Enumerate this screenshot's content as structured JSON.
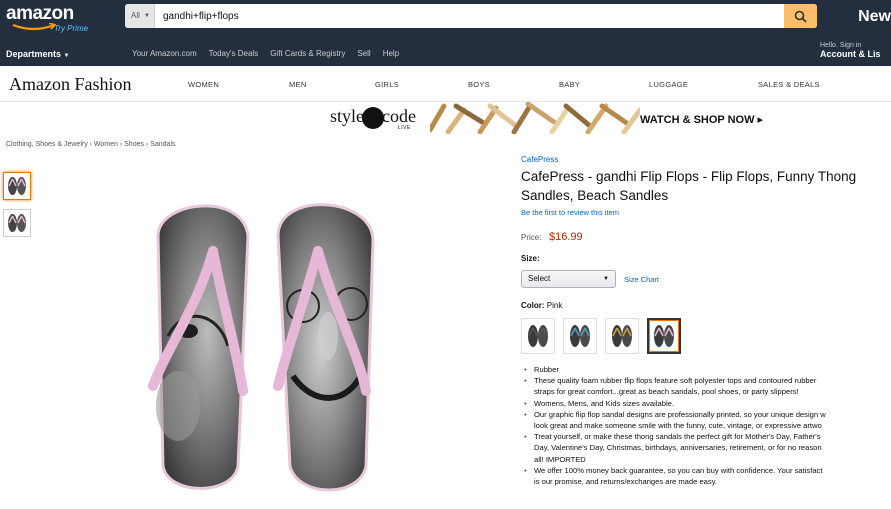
{
  "header": {
    "logo_text": "amazon",
    "logo_sub": "Try Prime",
    "search_category": "All",
    "search_value": "gandhi+flip+flops",
    "right_partial": "New"
  },
  "nav": {
    "departments_label": "Departments",
    "links": [
      "Your Amazon.com",
      "Today's Deals",
      "Gift Cards & Registry",
      "Sell",
      "Help"
    ],
    "hello": "Hello. Sign in",
    "account_label": "Account & Lis"
  },
  "fashion": {
    "logo": "Amazon Fashion",
    "nav": [
      "WOMEN",
      "MEN",
      "GIRLS",
      "BOYS",
      "BABY",
      "LUGGAGE",
      "SALES & DEALS"
    ]
  },
  "banner": {
    "style_text": "style",
    "code_text": "code",
    "live_text": "LIVE",
    "cta": "WATCH & SHOP NOW ▸"
  },
  "breadcrumb": "Clothing, Shoes & Jewelry › Women › Shoes › Sandals",
  "product": {
    "brand": "CafePress",
    "title_line1": "CafePress - gandhi Flip Flops - Flip Flops, Funny Thong",
    "title_line2": "Sandles, Beach Sandles",
    "review_link": "Be the first to review this item",
    "price_label": "Price:",
    "price": "$16.99",
    "size_label": "Size:",
    "size_selected": "Select",
    "size_chart": "Size Chart",
    "color_label": "Color:",
    "color_value": "Pink",
    "swatch_strap_colors": [
      "#555555",
      "#5b9bb5",
      "#c89a4a",
      "#e6b7d6"
    ],
    "bullets": [
      "Rubber",
      "These quality foam rubber flip flops feature soft polyester tops and contoured rubber",
      "straps for great comfort...great as beach sandals, pool shoes, or party slippers!",
      "Womens, Mens, and Kids sizes available.",
      "Our graphic flip flop sandal designs are professionally printed, so your unique design w",
      "look great and make someone smile with the funny, cute, vintage, or expressive artwo",
      "Treat yourself, or make these thong sandals the perfect gift for Mother's Day, Father's",
      "Day, Valentine's Day, Christmas, birthdays, anniversaries, retirement, or for no reason",
      "all! IMPORTED",
      "We offer 100% money back guarantee, so you can buy with confidence. Your satisfact",
      "is our promise, and returns/exchanges are made easy."
    ]
  }
}
